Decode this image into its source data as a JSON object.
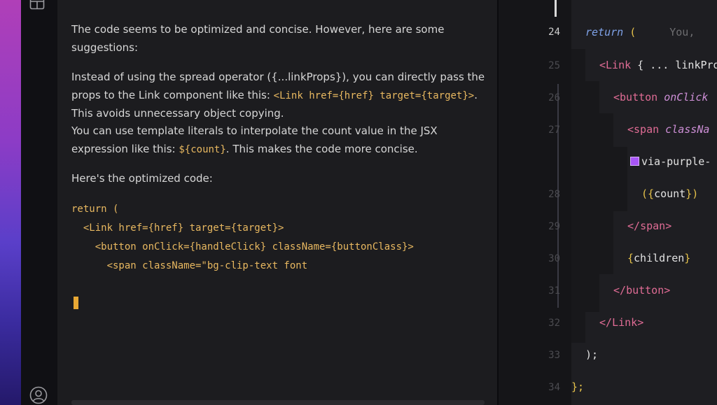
{
  "chat": {
    "intro": "The code seems to be optimized and concise. However, here are some suggestions:",
    "suggestion1": {
      "before": "Instead of using the spread operator ({...linkProps}), you can directly pass the props to the Link component like this: ",
      "code": "<Link href={href} target={target}>",
      "after": ". This avoids unnecessary object copying."
    },
    "suggestion2": {
      "before": "You can use template literals to interpolate the count value in the JSX expression like this: ",
      "code": "${count}",
      "after": ". This makes the code more concise."
    },
    "code_intro": "Here's the optimized code:",
    "code_lines": [
      "return (",
      "  <Link href={href} target={target}>",
      "    <button onClick={handleClick} className={buttonClass}>",
      "      <span className=\"bg-clip-text font"
    ]
  },
  "editor": {
    "line_numbers": [
      "24",
      "25",
      "26",
      "27",
      "28",
      "29",
      "30",
      "31",
      "32",
      "33",
      "34"
    ],
    "active_line": "24",
    "blame": "You,",
    "lines": {
      "l24": {
        "kw": "return",
        "paren": " ("
      },
      "l25": {
        "open": "<",
        "tag": "Link",
        "rest": " { ... linkPro"
      },
      "l26": {
        "open": "<",
        "tag": "button",
        "attr": " onClick"
      },
      "l27": {
        "open": "<",
        "tag": "span",
        "attr": " classNa"
      },
      "l28": {
        "text": "via-purple-"
      },
      "l29": {
        "open": "({",
        "ident": "count",
        "close": "})"
      },
      "l30": {
        "open": "</",
        "tag": "span",
        "close": ">"
      },
      "l31": {
        "open": "{",
        "ident": "children",
        "close": "}"
      },
      "l32": {
        "open": "</",
        "tag": "button",
        "close": ">"
      },
      "l33": {
        "open": "</",
        "tag": "Link",
        "close": ">"
      },
      "l34": {
        "text": ");"
      },
      "l35": {
        "text": "};"
      }
    }
  },
  "colors": {
    "accent_orange": "#e8b860",
    "swatch": "#a855f7",
    "desktop_gradient": "#8c3cc6"
  },
  "icons": [
    "layout-icon",
    "account-icon",
    "color-swatch-icon"
  ]
}
